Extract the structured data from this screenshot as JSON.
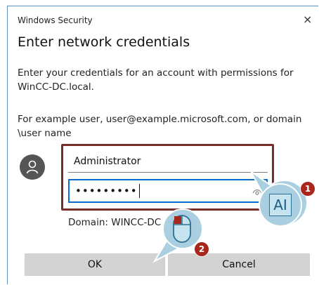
{
  "window": {
    "app_title": "Windows Security",
    "close_glyph": "×",
    "heading": "Enter network credentials"
  },
  "instructions": {
    "line1": "Enter your credentials for an account with permissions for",
    "line2": "WinCC-DC.local.",
    "example1": "For example user, user@example.microsoft.com, or domain",
    "example2": "\\user name"
  },
  "form": {
    "username_value": "Administrator",
    "password_value": "•••••••••",
    "domain_text": "Domain: WINCC-DC"
  },
  "buttons": {
    "ok_label": "OK",
    "cancel_label": "Cancel"
  },
  "callouts": {
    "step1_number": "1",
    "step1_icon_text": "AI",
    "step2_number": "2"
  },
  "colors": {
    "highlight": "#7a2e28",
    "accent": "#0a6ed1",
    "callout_fill": "#a9cfe0",
    "badge": "#a9261d"
  },
  "icons": [
    "user-avatar-icon",
    "close-icon",
    "reveal-password-icon",
    "text-cursor-icon",
    "mouse-icon"
  ]
}
